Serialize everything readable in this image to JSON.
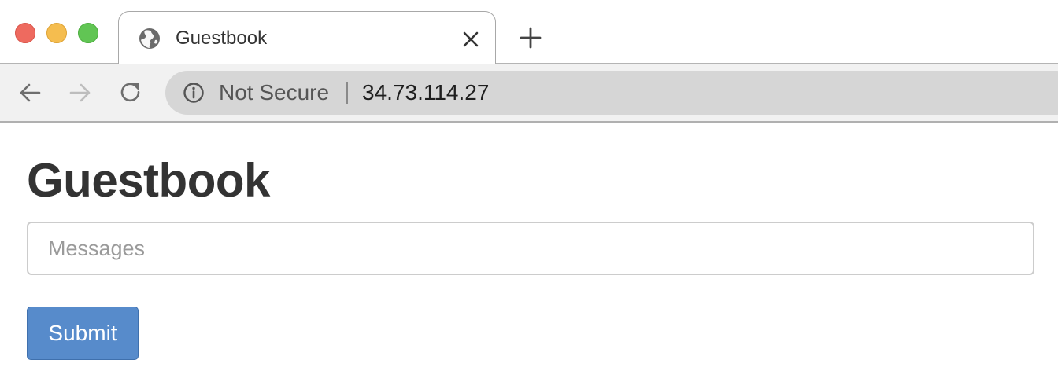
{
  "browser": {
    "window_controls": {
      "close_color": "#ee6a5f",
      "minimize_color": "#f5bd4f",
      "maximize_color": "#61c554"
    },
    "tab": {
      "title": "Guestbook",
      "favicon": "globe-icon",
      "close_icon": "close-icon"
    },
    "new_tab_icon": "plus-icon",
    "toolbar": {
      "back_icon": "arrow-left-icon",
      "forward_icon": "arrow-right-icon",
      "reload_icon": "reload-icon",
      "security_icon": "info-icon",
      "security_label": "Not Secure",
      "url": "34.73.114.27"
    }
  },
  "page": {
    "title": "Guestbook",
    "message_input": {
      "placeholder": "Messages",
      "value": ""
    },
    "submit_label": "Submit",
    "submit_color": "#578bcb"
  }
}
